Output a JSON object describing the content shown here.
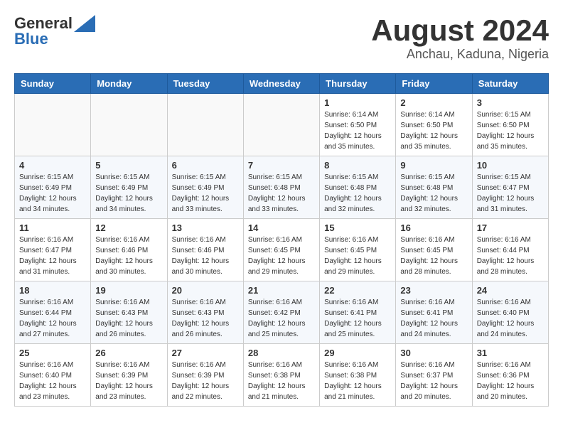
{
  "logo": {
    "general": "General",
    "blue": "Blue"
  },
  "header": {
    "month": "August 2024",
    "location": "Anchau, Kaduna, Nigeria"
  },
  "weekdays": [
    "Sunday",
    "Monday",
    "Tuesday",
    "Wednesday",
    "Thursday",
    "Friday",
    "Saturday"
  ],
  "weeks": [
    [
      {
        "day": "",
        "info": ""
      },
      {
        "day": "",
        "info": ""
      },
      {
        "day": "",
        "info": ""
      },
      {
        "day": "",
        "info": ""
      },
      {
        "day": "1",
        "info": "Sunrise: 6:14 AM\nSunset: 6:50 PM\nDaylight: 12 hours\nand 35 minutes."
      },
      {
        "day": "2",
        "info": "Sunrise: 6:14 AM\nSunset: 6:50 PM\nDaylight: 12 hours\nand 35 minutes."
      },
      {
        "day": "3",
        "info": "Sunrise: 6:15 AM\nSunset: 6:50 PM\nDaylight: 12 hours\nand 35 minutes."
      }
    ],
    [
      {
        "day": "4",
        "info": "Sunrise: 6:15 AM\nSunset: 6:49 PM\nDaylight: 12 hours\nand 34 minutes."
      },
      {
        "day": "5",
        "info": "Sunrise: 6:15 AM\nSunset: 6:49 PM\nDaylight: 12 hours\nand 34 minutes."
      },
      {
        "day": "6",
        "info": "Sunrise: 6:15 AM\nSunset: 6:49 PM\nDaylight: 12 hours\nand 33 minutes."
      },
      {
        "day": "7",
        "info": "Sunrise: 6:15 AM\nSunset: 6:48 PM\nDaylight: 12 hours\nand 33 minutes."
      },
      {
        "day": "8",
        "info": "Sunrise: 6:15 AM\nSunset: 6:48 PM\nDaylight: 12 hours\nand 32 minutes."
      },
      {
        "day": "9",
        "info": "Sunrise: 6:15 AM\nSunset: 6:48 PM\nDaylight: 12 hours\nand 32 minutes."
      },
      {
        "day": "10",
        "info": "Sunrise: 6:15 AM\nSunset: 6:47 PM\nDaylight: 12 hours\nand 31 minutes."
      }
    ],
    [
      {
        "day": "11",
        "info": "Sunrise: 6:16 AM\nSunset: 6:47 PM\nDaylight: 12 hours\nand 31 minutes."
      },
      {
        "day": "12",
        "info": "Sunrise: 6:16 AM\nSunset: 6:46 PM\nDaylight: 12 hours\nand 30 minutes."
      },
      {
        "day": "13",
        "info": "Sunrise: 6:16 AM\nSunset: 6:46 PM\nDaylight: 12 hours\nand 30 minutes."
      },
      {
        "day": "14",
        "info": "Sunrise: 6:16 AM\nSunset: 6:45 PM\nDaylight: 12 hours\nand 29 minutes."
      },
      {
        "day": "15",
        "info": "Sunrise: 6:16 AM\nSunset: 6:45 PM\nDaylight: 12 hours\nand 29 minutes."
      },
      {
        "day": "16",
        "info": "Sunrise: 6:16 AM\nSunset: 6:45 PM\nDaylight: 12 hours\nand 28 minutes."
      },
      {
        "day": "17",
        "info": "Sunrise: 6:16 AM\nSunset: 6:44 PM\nDaylight: 12 hours\nand 28 minutes."
      }
    ],
    [
      {
        "day": "18",
        "info": "Sunrise: 6:16 AM\nSunset: 6:44 PM\nDaylight: 12 hours\nand 27 minutes."
      },
      {
        "day": "19",
        "info": "Sunrise: 6:16 AM\nSunset: 6:43 PM\nDaylight: 12 hours\nand 26 minutes."
      },
      {
        "day": "20",
        "info": "Sunrise: 6:16 AM\nSunset: 6:43 PM\nDaylight: 12 hours\nand 26 minutes."
      },
      {
        "day": "21",
        "info": "Sunrise: 6:16 AM\nSunset: 6:42 PM\nDaylight: 12 hours\nand 25 minutes."
      },
      {
        "day": "22",
        "info": "Sunrise: 6:16 AM\nSunset: 6:41 PM\nDaylight: 12 hours\nand 25 minutes."
      },
      {
        "day": "23",
        "info": "Sunrise: 6:16 AM\nSunset: 6:41 PM\nDaylight: 12 hours\nand 24 minutes."
      },
      {
        "day": "24",
        "info": "Sunrise: 6:16 AM\nSunset: 6:40 PM\nDaylight: 12 hours\nand 24 minutes."
      }
    ],
    [
      {
        "day": "25",
        "info": "Sunrise: 6:16 AM\nSunset: 6:40 PM\nDaylight: 12 hours\nand 23 minutes."
      },
      {
        "day": "26",
        "info": "Sunrise: 6:16 AM\nSunset: 6:39 PM\nDaylight: 12 hours\nand 23 minutes."
      },
      {
        "day": "27",
        "info": "Sunrise: 6:16 AM\nSunset: 6:39 PM\nDaylight: 12 hours\nand 22 minutes."
      },
      {
        "day": "28",
        "info": "Sunrise: 6:16 AM\nSunset: 6:38 PM\nDaylight: 12 hours\nand 21 minutes."
      },
      {
        "day": "29",
        "info": "Sunrise: 6:16 AM\nSunset: 6:38 PM\nDaylight: 12 hours\nand 21 minutes."
      },
      {
        "day": "30",
        "info": "Sunrise: 6:16 AM\nSunset: 6:37 PM\nDaylight: 12 hours\nand 20 minutes."
      },
      {
        "day": "31",
        "info": "Sunrise: 6:16 AM\nSunset: 6:36 PM\nDaylight: 12 hours\nand 20 minutes."
      }
    ]
  ]
}
